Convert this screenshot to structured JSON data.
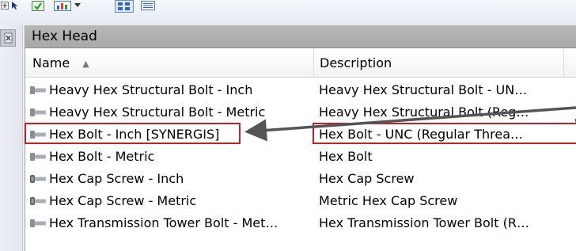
{
  "panel": {
    "title": "Hex Head"
  },
  "table": {
    "columns": [
      {
        "label": "Name",
        "sorted": "ascending"
      },
      {
        "label": "Description"
      }
    ],
    "rows": [
      {
        "name": "Heavy Hex Structural Bolt - Inch",
        "description": "Heavy Hex Structural Bolt - UN…",
        "icon": "hex-bolt-icon"
      },
      {
        "name": "Heavy Hex Structural Bolt - Metric",
        "description": "Heavy Hex Structural Bolt (Reg…",
        "icon": "hex-bolt-icon"
      },
      {
        "name": "Hex Bolt - Inch [SYNERGIS]",
        "description": "Hex Bolt - UNC (Regular Threa…",
        "icon": "hex-bolt-icon",
        "highlighted": true
      },
      {
        "name": "Hex Bolt - Metric",
        "description": "Hex Bolt",
        "icon": "hex-bolt-icon"
      },
      {
        "name": "Hex Cap Screw - Inch",
        "description": "Hex Cap Screw",
        "icon": "cap-screw-icon"
      },
      {
        "name": "Hex Cap Screw - Metric",
        "description": "Metric Hex Cap Screw",
        "icon": "cap-screw-icon"
      },
      {
        "name": "Hex Transmission Tower Bolt - Met…",
        "description": "Hex Transmission Tower Bolt (R…",
        "icon": "hex-bolt-icon"
      }
    ]
  },
  "toolbar": {
    "icons": [
      "expand-icon",
      "select-cursor-icon",
      "green-check-icon",
      "chart-icon",
      "dropdown-arrow-icon",
      "large-icons-view-icon",
      "details-view-icon"
    ]
  },
  "colors": {
    "callout": "#c0202a",
    "arrow": "#555555",
    "panel_title_bg": "#b0b0b0"
  }
}
